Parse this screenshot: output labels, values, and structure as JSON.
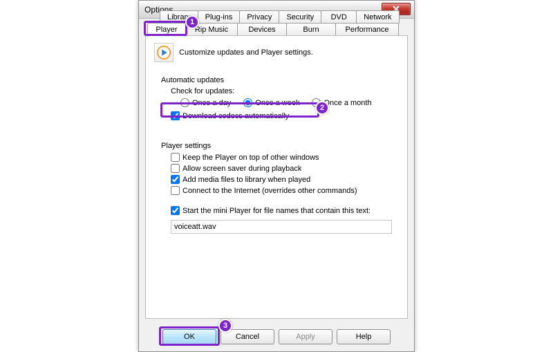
{
  "window": {
    "title": "Options"
  },
  "tabs_row1": [
    "Library",
    "Plug-ins",
    "Privacy",
    "Security",
    "DVD",
    "Network"
  ],
  "tabs_row2": [
    "Player",
    "Rip Music",
    "Devices",
    "Burn",
    "Performance"
  ],
  "header_text": "Customize updates and Player settings.",
  "updates_group": {
    "title": "Automatic updates",
    "check_label": "Check for updates:",
    "radios": {
      "day": "Once a day",
      "week": "Once a week",
      "month": "Once a month"
    },
    "download_codecs": "Download codecs automatically"
  },
  "player_group": {
    "title": "Player settings",
    "keep_top": "Keep the Player on top of other windows",
    "screensaver": "Allow screen saver during playback",
    "add_media": "Add media files to library when played",
    "connect_internet": "Connect to the Internet (overrides other commands)",
    "mini_player": "Start the mini Player for file names that contain this text:",
    "input_value": "voiceatt.wav"
  },
  "buttons": {
    "ok": "OK",
    "cancel": "Cancel",
    "apply": "Apply",
    "help": "Help"
  },
  "annotations": {
    "b1": "1",
    "b2": "2",
    "b3": "3"
  }
}
